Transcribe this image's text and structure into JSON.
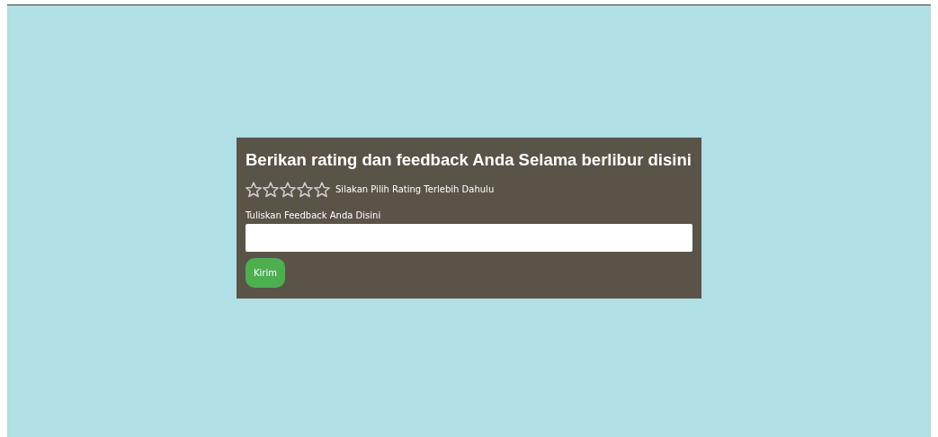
{
  "title": "Berikan rating dan feedback Anda Selama berlibur disini",
  "rating": {
    "stars": 0,
    "hint": "Silakan Pilih Rating Terlebih Dahulu"
  },
  "feedback": {
    "label": "Tuliskan Feedback Anda Disini"
  },
  "buttons": [
    "Kirim"
  ]
}
